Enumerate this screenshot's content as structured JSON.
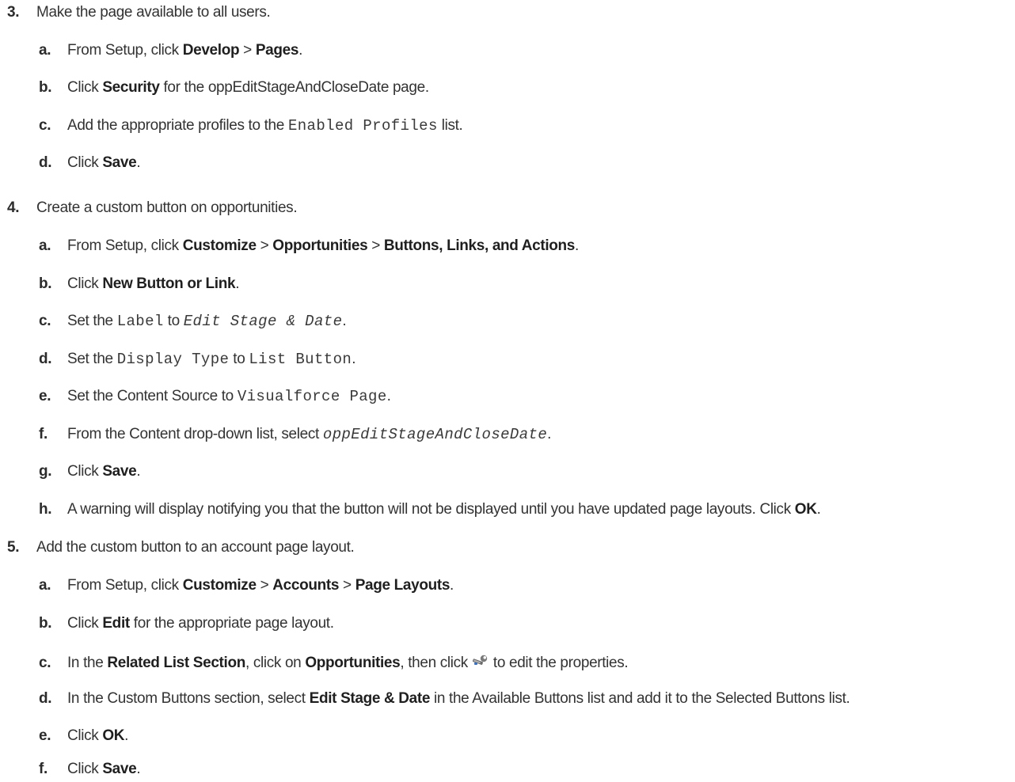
{
  "steps": [
    {
      "num": "3.",
      "text": "Make the page available to all users.",
      "subs": [
        {
          "num": "a.",
          "t1": "From Setup, click ",
          "b1": "Develop",
          "t2": " > ",
          "b2": "Pages",
          "t3": "."
        },
        {
          "num": "b.",
          "t1": "Click ",
          "b1": "Security",
          "t2": " for the oppEditStageAndCloseDate page."
        },
        {
          "num": "c.",
          "t1": "Add the appropriate profiles to the ",
          "m1": "Enabled Profiles",
          "t2": " list."
        },
        {
          "num": "d.",
          "t1": "Click ",
          "b1": "Save",
          "t2": "."
        }
      ]
    },
    {
      "num": "4.",
      "text": "Create a custom button on opportunities.",
      "subs": [
        {
          "num": "a.",
          "t1": "From Setup, click ",
          "b1": "Customize",
          "t2": " > ",
          "b2": "Opportunities",
          "t3": " > ",
          "b3": "Buttons, Links, and Actions",
          "t4": "."
        },
        {
          "num": "b.",
          "t1": "Click ",
          "b1": "New Button or Link",
          "t2": "."
        },
        {
          "num": "c.",
          "t1": "Set the ",
          "m1": "Label",
          "t2": " to ",
          "m2": "Edit Stage & Date",
          "t3": "."
        },
        {
          "num": "d.",
          "t1": "Set the ",
          "m1": "Display Type",
          "t2": " to ",
          "m2": "List Button",
          "t3": "."
        },
        {
          "num": "e.",
          "t1": "Set the Content Source to ",
          "m1": "Visualforce Page",
          "t2": "."
        },
        {
          "num": "f.",
          "t1": "From the Content drop-down list, select ",
          "m1": "oppEditStageAndCloseDate",
          "t2": "."
        },
        {
          "num": "g.",
          "t1": "Click ",
          "b1": "Save",
          "t2": "."
        },
        {
          "num": "h.",
          "t1": "A warning will display notifying you that the button will not be displayed until you have updated page layouts. Click ",
          "b1": "OK",
          "t2": "."
        }
      ]
    },
    {
      "num": "5.",
      "text": "Add the custom button to an account page layout.",
      "subs": [
        {
          "num": "a.",
          "t1": "From Setup, click ",
          "b1": "Customize",
          "t2": " > ",
          "b2": "Accounts",
          "t3": " > ",
          "b3": "Page Layouts",
          "t4": "."
        },
        {
          "num": "b.",
          "t1": "Click ",
          "b1": "Edit",
          "t2": " for the appropriate page layout."
        },
        {
          "num": "c.",
          "t1": "In the ",
          "b1": "Related List Section",
          "t2": ", click on ",
          "b2": "Opportunities",
          "t3": ", then click",
          "icon": "wrench-icon",
          "t4": "to edit the properties."
        },
        {
          "num": "d.",
          "t1": "In the Custom Buttons section, select ",
          "b1": "Edit Stage & Date",
          "t2": " in the Available Buttons list and add it to the Selected Buttons list."
        },
        {
          "num": "e.",
          "t1": "Click ",
          "b1": "OK",
          "t2": "."
        },
        {
          "num": "f.",
          "t1": "Click ",
          "b1": "Save",
          "t2": "."
        }
      ]
    }
  ]
}
